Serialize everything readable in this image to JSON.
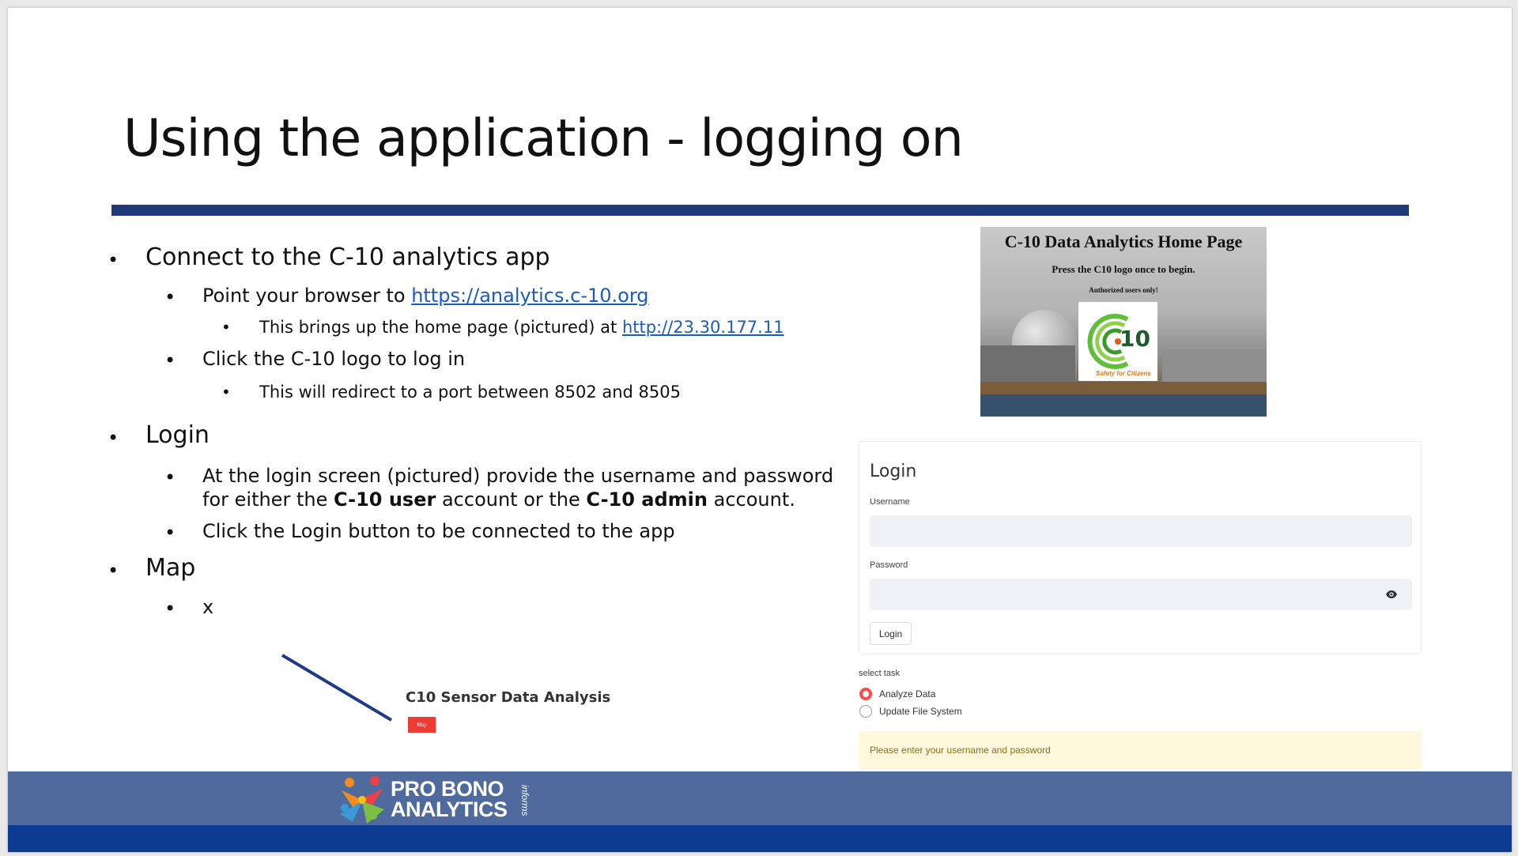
{
  "slide": {
    "title": "Using the application - logging on",
    "bullets": {
      "connect": "Connect to the C-10 analytics app",
      "point_prefix": "Point your browser to ",
      "point_link": "https://analytics.c-10.org",
      "brings_prefix": "This brings up the home page (pictured) at ",
      "brings_link": "http://23.30.177.11",
      "click_logo": "Click the C-10 logo to log in",
      "redirect": "This will redirect to a port between 8502 and 8505",
      "login": "Login",
      "login_line1": "At the login screen (pictured) provide the username and password",
      "login_line2_a": "for either the ",
      "login_line2_b": "C-10 user",
      "login_line2_c": " account or the ",
      "login_line2_d": "C-10 admin",
      "login_line2_e": " account.",
      "click_login": "Click the Login button to be connected to the app",
      "map": "Map",
      "map_sub": "x",
      "bullet_char": "•"
    }
  },
  "home_image": {
    "title": "C-10 Data Analytics Home Page",
    "subtitle": "Press the C10 logo once to begin.",
    "authorized": "Authorized users only!",
    "logo_text": "10",
    "logo_tagline": "Safety for Citizens"
  },
  "login_form": {
    "title": "Login",
    "username_label": "Username",
    "username_value": "",
    "password_label": "Password",
    "password_value": "",
    "button_label": "Login"
  },
  "task_select": {
    "label": "select task",
    "options": [
      "Analyze Data",
      "Update File System"
    ],
    "selected": "Analyze Data"
  },
  "warning": {
    "text": "Please enter your username and password"
  },
  "map_preview": {
    "title": "C10 Sensor Data Analysis",
    "button": "Map"
  },
  "footer": {
    "line1": "PRO BONO",
    "line2": "ANALYTICS",
    "informs": "informs"
  },
  "colors": {
    "title_rule": "#1f3a78",
    "footer": "#4f6a9c",
    "footer_bar": "#0d3b91",
    "radio_accent": "#ff4b4b",
    "map_button": "#ee3b33",
    "link": "#1a5bc4"
  }
}
